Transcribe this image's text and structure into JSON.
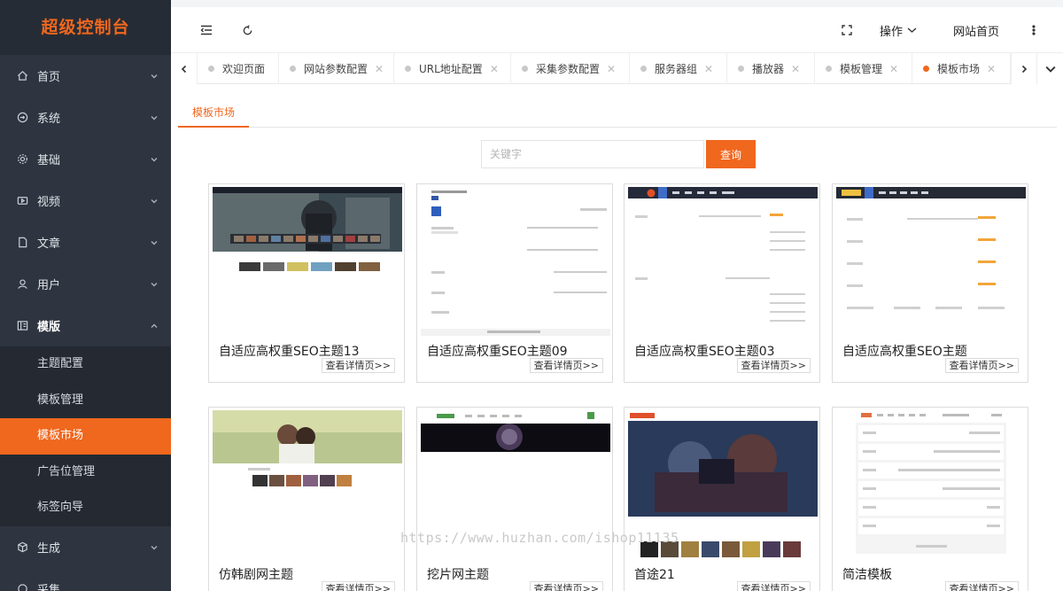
{
  "brand": {
    "title": "超级控制台",
    "accent": "#f0671e"
  },
  "sidebar": {
    "items": [
      {
        "label": "首页",
        "icon": "home-icon"
      },
      {
        "label": "系统",
        "icon": "system-icon"
      },
      {
        "label": "基础",
        "icon": "gear-icon"
      },
      {
        "label": "视频",
        "icon": "video-icon"
      },
      {
        "label": "文章",
        "icon": "document-icon"
      },
      {
        "label": "用户",
        "icon": "user-icon"
      },
      {
        "label": "模版",
        "icon": "template-icon"
      }
    ],
    "submenu": [
      {
        "label": "主题配置"
      },
      {
        "label": "模板管理"
      },
      {
        "label": "模板市场"
      },
      {
        "label": "广告位管理"
      },
      {
        "label": "标签向导"
      }
    ],
    "after": [
      {
        "label": "生成",
        "icon": "cube-icon"
      },
      {
        "label": "采集",
        "icon": "collect-icon"
      }
    ]
  },
  "header": {
    "menu_label": "操作",
    "home_label": "网站首页"
  },
  "tabs": [
    {
      "label": "欢迎页面",
      "closable": false
    },
    {
      "label": "网站参数配置",
      "closable": true
    },
    {
      "label": "URL地址配置",
      "closable": true
    },
    {
      "label": "采集参数配置",
      "closable": true
    },
    {
      "label": "服务器组",
      "closable": true
    },
    {
      "label": "播放器",
      "closable": true
    },
    {
      "label": "模板管理",
      "closable": true
    },
    {
      "label": "模板市场",
      "closable": true
    }
  ],
  "content": {
    "sub_tab": "模板市场",
    "search_placeholder": "关键字",
    "search_button": "查询",
    "detail_label": "查看详情页>>",
    "cards": [
      {
        "title": "自适应高权重SEO主题13"
      },
      {
        "title": "自适应高权重SEO主题09"
      },
      {
        "title": "自适应高权重SEO主题03"
      },
      {
        "title": "自适应高权重SEO主题"
      },
      {
        "title": "仿韩剧网主题"
      },
      {
        "title": "挖片网主题"
      },
      {
        "title": "首途21"
      },
      {
        "title": "简洁模板"
      }
    ]
  },
  "watermark": "https://www.huzhan.com/ishop11135"
}
